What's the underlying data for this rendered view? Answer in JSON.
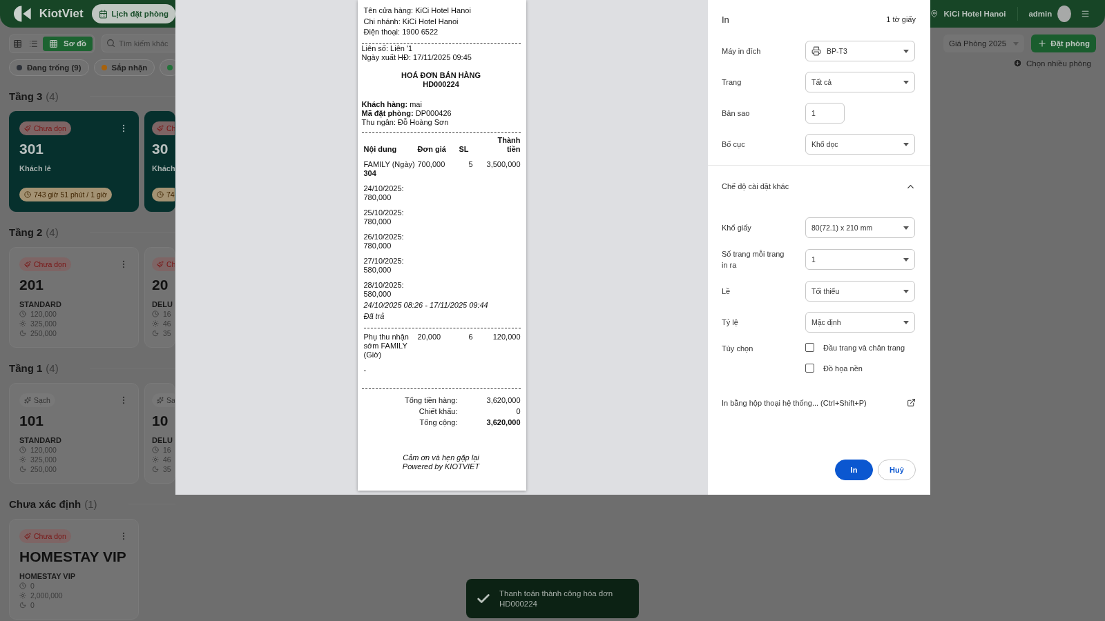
{
  "app": {
    "logo": "KiotViet",
    "booking_button": "Lịch đặt phòng",
    "branch": "KiCi Hotel Hanoi",
    "user": "admin",
    "view_modes": [
      {
        "kind": "table",
        "selected": false
      },
      {
        "kind": "list",
        "selected": false
      },
      {
        "kind": "grid",
        "label": "Sơ đồ",
        "selected": true
      }
    ],
    "search": {
      "placeholder": "Tìm kiếm khác"
    },
    "filters": [
      {
        "label": "Đang trống (9)",
        "color": "#2e323a"
      },
      {
        "label": "Sắp nhận",
        "color": "#a8620c"
      },
      {
        "color": "#23723a"
      }
    ],
    "price_list": "Giá Phòng 2025",
    "add_booking": "Đặt phòng",
    "multi_select": "Chọn nhiều phòng",
    "floors": [
      {
        "name": "Tầng 3",
        "count": "(4)",
        "rooms": [
          {
            "kind": "occupied",
            "status": {
              "kind": "dirty",
              "label": "Chưa dọn"
            },
            "menu": true,
            "number": "301",
            "guest": "Khách lẻ",
            "timer": "743 giờ 51 phút / 1 giờ"
          },
          {
            "kind": "occupied",
            "status": {
              "kind": "dirty",
              "label": "Ch"
            },
            "menu": false,
            "number": "30",
            "guest": "Khách",
            "timer": "74"
          }
        ]
      },
      {
        "name": "Tầng 2",
        "count": "(4)",
        "rooms": [
          {
            "kind": "vacant",
            "status": {
              "kind": "dirty",
              "label": "Chưa dọn"
            },
            "menu": true,
            "number": "201",
            "room_type": "STANDARD",
            "rates": [
              {
                "kind": "hourly",
                "value": "120,000"
              },
              {
                "kind": "daily",
                "value": "325,000"
              },
              {
                "kind": "overnight",
                "value": "250,000"
              }
            ]
          },
          {
            "kind": "vacant",
            "status": {
              "kind": "dirty",
              "label": "Ch"
            },
            "menu": false,
            "number": "20",
            "room_type": "DELU",
            "rates": [
              {
                "kind": "hourly",
                "value": "16"
              },
              {
                "kind": "daily",
                "value": "46"
              },
              {
                "kind": "overnight",
                "value": "35"
              }
            ]
          }
        ]
      },
      {
        "name": "Tầng 1",
        "count": "(4)",
        "rooms": [
          {
            "kind": "vacant",
            "status": {
              "kind": "clean",
              "label": "Sạch"
            },
            "menu": true,
            "number": "101",
            "room_type": "STANDARD",
            "rates": [
              {
                "kind": "hourly",
                "value": "120,000"
              },
              {
                "kind": "daily",
                "value": "325,000"
              },
              {
                "kind": "overnight",
                "value": "250,000"
              }
            ]
          },
          {
            "kind": "vacant",
            "status": {
              "kind": "clean",
              "label": "Sa"
            },
            "menu": false,
            "number": "10",
            "room_type": "DELU",
            "rates": [
              {
                "kind": "hourly",
                "value": "16"
              },
              {
                "kind": "daily",
                "value": "46"
              },
              {
                "kind": "overnight",
                "value": "35"
              }
            ]
          }
        ]
      },
      {
        "name": "Chưa xác định",
        "count": "(1)",
        "rooms": [
          {
            "kind": "vacant",
            "status": {
              "kind": "dirty",
              "label": "Chưa dọn"
            },
            "menu": true,
            "number": "HOMESTAY VIP",
            "room_type": "HOMESTAY VIP",
            "rates": [
              {
                "kind": "hourly",
                "value": "0"
              },
              {
                "kind": "daily",
                "value": "2,000,000"
              },
              {
                "kind": "overnight",
                "value": "0"
              }
            ]
          }
        ]
      }
    ]
  },
  "receipt": {
    "header_lines": [
      "Tên cửa hàng: KiCi Hotel Hanoi",
      "Chi nhánh: KiCi Hotel Hanoi",
      "Điện thoại: 1900 6522"
    ],
    "meta_lines": [
      "Liên số: Liên '1",
      "Ngày xuất HĐ: 17/11/2025 09:45"
    ],
    "title": "HOÁ ĐƠN BÁN HÀNG",
    "code": "HD000224",
    "info": [
      "**Khách hàng:** mai",
      "**Mã đặt phòng:** DP000426",
      "Thu ngân: Đỗ Hoàng Sơn"
    ],
    "columns": [
      "Nội dung",
      "Đơn giá",
      "SL",
      "Thành tiền"
    ],
    "items": [
      {
        "name": "FAMILY (Ngày) **304**",
        "price": "700,000",
        "qty": "5",
        "total": "3,500,000",
        "notes": [
          "24/10/2025: 780,000",
          "25/10/2025: 780,000",
          "26/10/2025: 780,000",
          "27/10/2025: 580,000",
          "28/10/2025: 580,000"
        ],
        "period": "24/10/2025 08:26 - 17/11/2025 09:44",
        "status": "Đã trả"
      },
      {
        "name": "Phụ thu nhận sớm FAMILY (Giờ)",
        "price": "20,000",
        "qty": "6",
        "total": "120,000",
        "notes": [
          "-"
        ]
      }
    ],
    "totals": [
      {
        "label": "Tổng tiền hàng:",
        "value": "3,620,000",
        "emphasis": false
      },
      {
        "label": "Chiết khấu:",
        "value": "0",
        "emphasis": false
      },
      {
        "label": "Tổng cộng:",
        "value": "3,620,000",
        "emphasis": true
      }
    ],
    "footer": [
      "Cảm ơn và hẹn gặp lại",
      "Powered by KIOTVIET"
    ]
  },
  "print": {
    "title": "In",
    "sheets": "1 tờ giấy",
    "fields": [
      {
        "label": "Máy in đích",
        "kind": "printer",
        "value": "BP-T3"
      },
      {
        "label": "Trang",
        "kind": "select",
        "value": "Tất cả"
      },
      {
        "label": "Bản sao",
        "kind": "number",
        "value": "1"
      },
      {
        "label": "Bố cục",
        "kind": "select",
        "value": "Khổ dọc"
      }
    ],
    "more": {
      "label": "Chế độ cài đặt khác",
      "expanded": true
    },
    "more_fields": [
      {
        "label": "Khổ giấy",
        "kind": "select",
        "value": "80(72.1) x 210 mm"
      },
      {
        "label": "Số trang mỗi trang in ra",
        "kind": "select",
        "value": "1"
      },
      {
        "label": "Lề",
        "kind": "select",
        "value": "Tối thiểu"
      },
      {
        "label": "Tỷ lệ",
        "kind": "select",
        "value": "Mặc định"
      }
    ],
    "options": {
      "label": "Tùy chọn",
      "items": [
        {
          "label": "Đầu trang và chân trang",
          "checked": false
        },
        {
          "label": "Đồ họa nền",
          "checked": false
        }
      ]
    },
    "system_dialog": "In bằng hộp thoại hệ thống... (Ctrl+Shift+P)",
    "buttons": [
      {
        "label": "In",
        "kind": "primary"
      },
      {
        "label": "Huỷ",
        "kind": "secondary"
      }
    ]
  },
  "toast": {
    "message": "Thanh toán thành công hóa đơn HD000224"
  }
}
